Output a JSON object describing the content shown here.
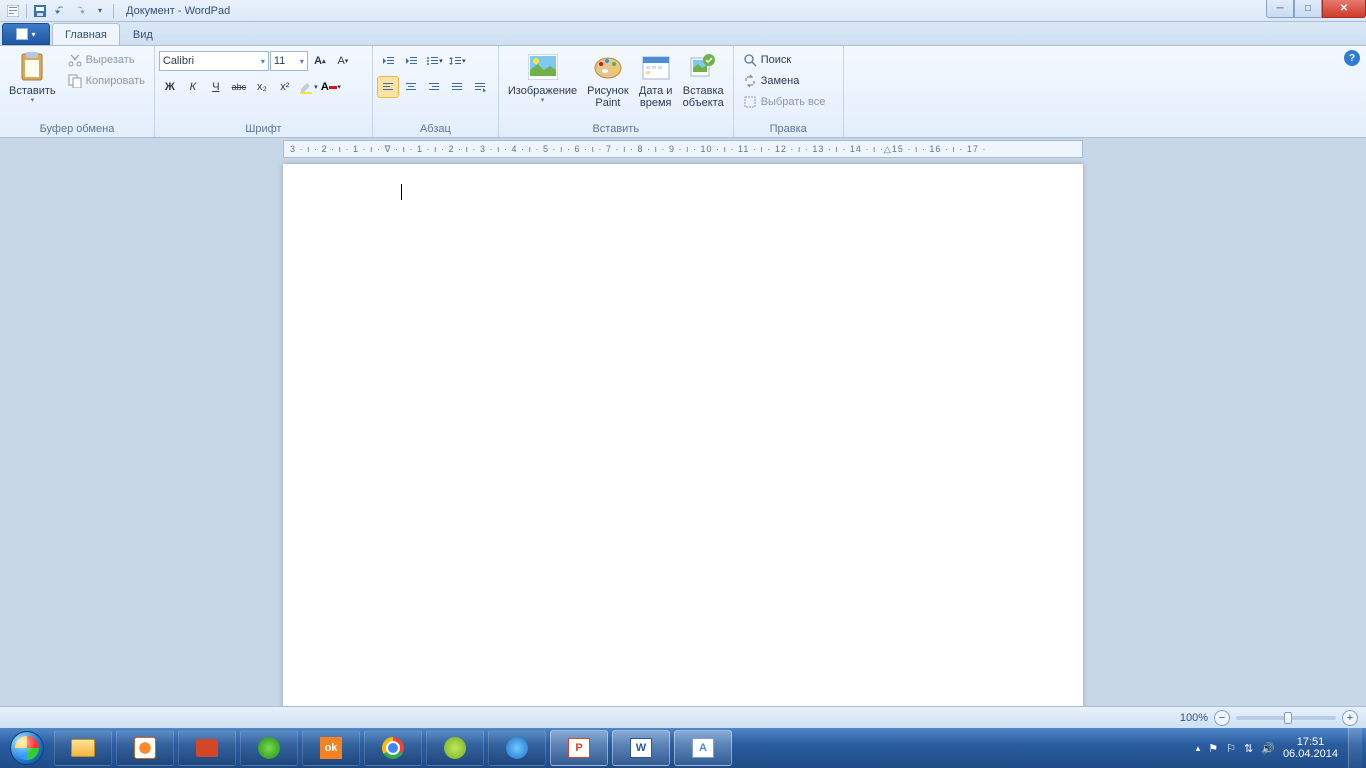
{
  "title": "Документ - WordPad",
  "tabs": {
    "home": "Главная",
    "view": "Вид"
  },
  "clipboard": {
    "paste": "Вставить",
    "cut": "Вырезать",
    "copy": "Копировать",
    "label": "Буфер обмена"
  },
  "font": {
    "family": "Calibri",
    "size": "11",
    "grow": "A↑",
    "shrink": "A↓",
    "bold": "Ж",
    "italic": "К",
    "underline": "Ч",
    "strike": "abc",
    "sub": "x₂",
    "sup": "x²",
    "label": "Шрифт"
  },
  "paragraph": {
    "label": "Абзац"
  },
  "insert": {
    "image": "Изображение",
    "paint": "Рисунок\nPaint",
    "datetime": "Дата и\nвремя",
    "object": "Вставка\nобъекта",
    "label": "Вставить"
  },
  "editing": {
    "find": "Поиск",
    "replace": "Замена",
    "selectall": "Выбрать все",
    "label": "Правка"
  },
  "ruler": "3 · ı · 2 · ı · 1 · ı · ∇ · ı · 1 · ı · 2 · ı · 3 · ı · 4 · ı · 5 · ı · 6 · ı · 7 · ı · 8 · ı · 9 · ı · 10 · ı · 11 · ı · 12 · ı · 13 · ı · 14 · ı ·△15 · ı · 16 · ı · 17 ·",
  "status": {
    "zoom": "100%"
  },
  "tray": {
    "time": "17:51",
    "date": "06.04.2014"
  }
}
